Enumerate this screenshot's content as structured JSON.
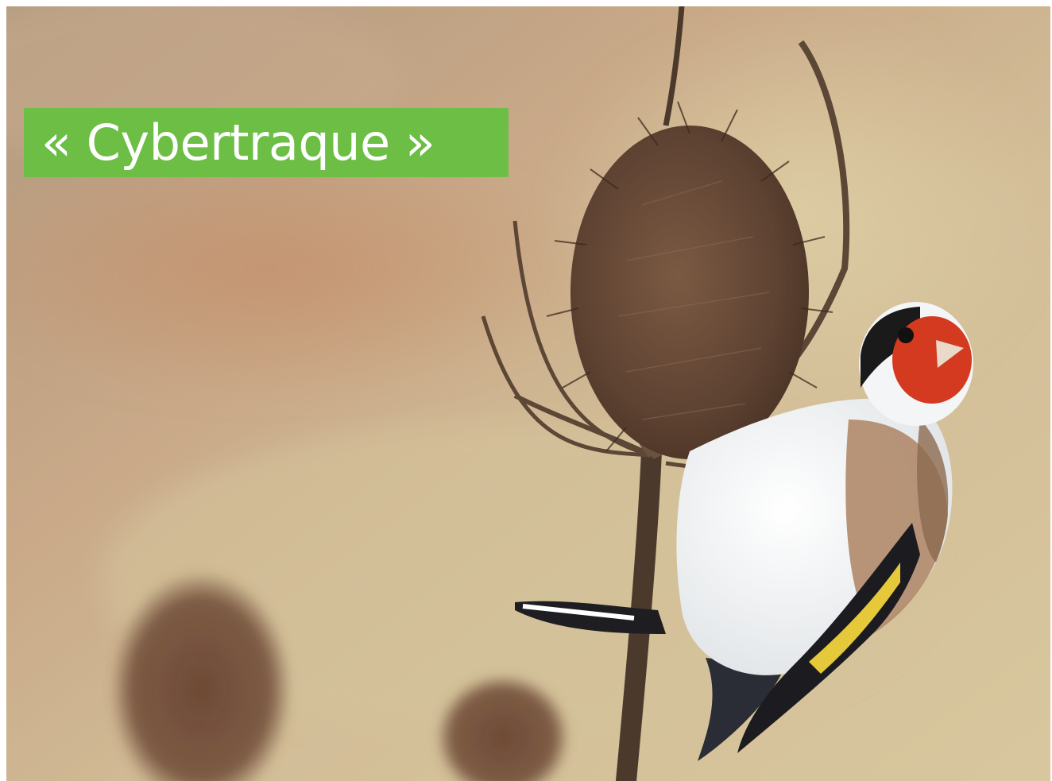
{
  "banner": {
    "text": "« Cybertraque »",
    "background_color": "#6cbe45",
    "text_color": "#ffffff"
  },
  "photo": {
    "subject": "goldfinch-on-teasel",
    "background_tone": "#c8b48c"
  }
}
